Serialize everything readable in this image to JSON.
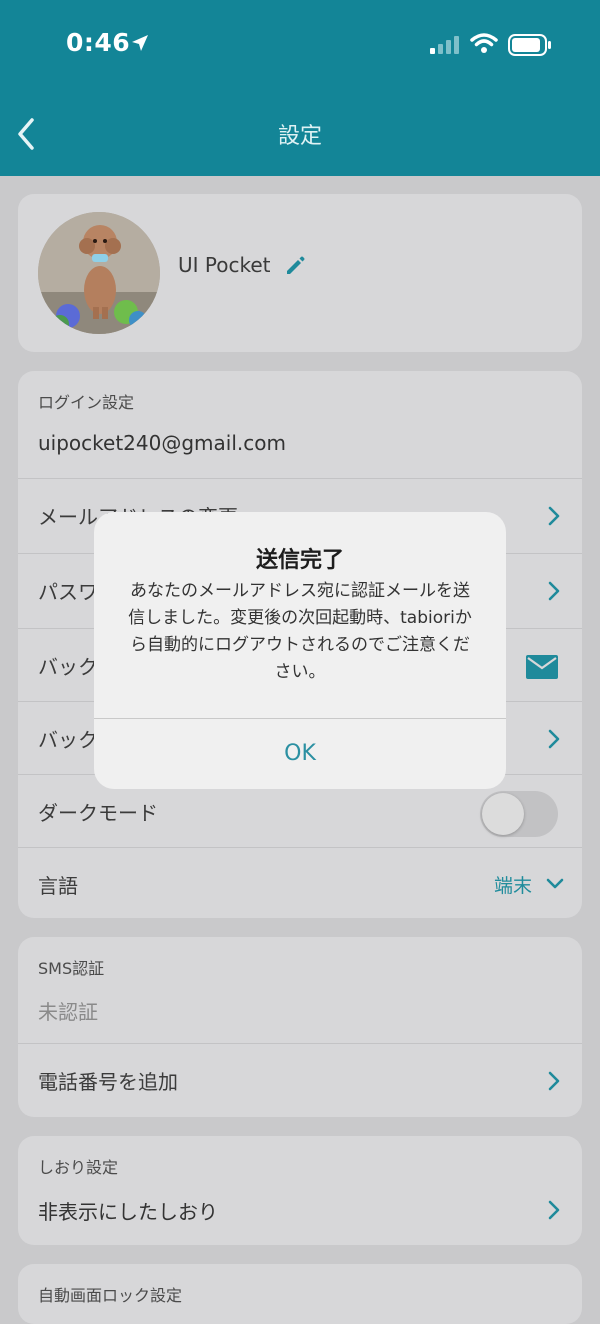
{
  "status_bar": {
    "time": "0:46"
  },
  "nav": {
    "title": "設定"
  },
  "profile": {
    "name": "UI Pocket"
  },
  "login": {
    "header": "ログイン設定",
    "email": "uipocket240@gmail.com",
    "rows": [
      {
        "label": "メールアドレスの変更"
      },
      {
        "label": "パスワード"
      },
      {
        "label": "バック"
      },
      {
        "label": "バック"
      }
    ],
    "dark_mode": {
      "label": "ダークモード",
      "enabled": false
    },
    "language": {
      "label": "言語",
      "value": "端末"
    }
  },
  "sms": {
    "header": "SMS認証",
    "status": "未認証",
    "add_phone": "電話番号を追加"
  },
  "bookmark": {
    "header": "しおり設定",
    "hidden": "非表示にしたしおり"
  },
  "autolock": {
    "header": "自動画面ロック設定"
  },
  "dialog": {
    "title": "送信完了",
    "message": "あなたのメールアドレス宛に認証メールを送信しました。変更後の次回起動時、tabioriから自動的にログアウトされるのでご注意ください。",
    "ok": "OK"
  },
  "colors": {
    "accent": "#138597",
    "link": "#208c9c"
  }
}
